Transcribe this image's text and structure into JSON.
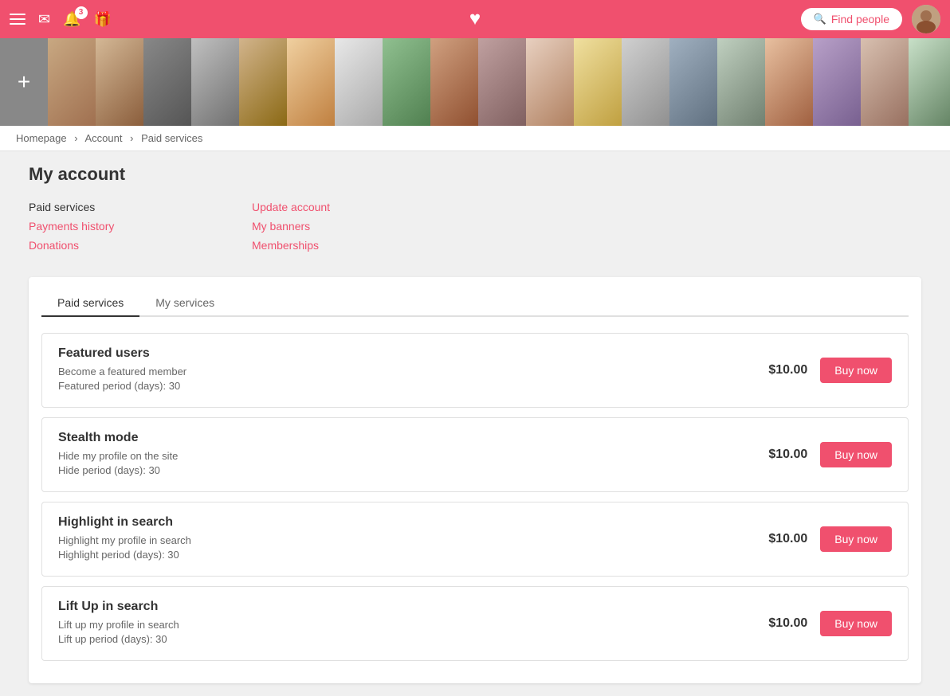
{
  "topnav": {
    "find_people_label": "Find people",
    "badge_count": "3"
  },
  "breadcrumb": {
    "home": "Homepage",
    "account": "Account",
    "current": "Paid services"
  },
  "page": {
    "title": "My account"
  },
  "account_menu": {
    "col1": [
      {
        "label": "Paid services",
        "active": false
      },
      {
        "label": "Payments history",
        "active": true
      },
      {
        "label": "Donations",
        "active": true
      }
    ],
    "col2": [
      {
        "label": "Update account",
        "active": true
      },
      {
        "label": "My banners",
        "active": true
      },
      {
        "label": "Memberships",
        "active": true
      }
    ]
  },
  "tabs": [
    {
      "label": "Paid services",
      "active": true
    },
    {
      "label": "My services",
      "active": false
    }
  ],
  "services": [
    {
      "title": "Featured users",
      "desc1": "Become a featured member",
      "desc2": "Featured period (days): 30",
      "price": "$10.00",
      "btn_label": "Buy now"
    },
    {
      "title": "Stealth mode",
      "desc1": "Hide my profile on the site",
      "desc2": "Hide period (days): 30",
      "price": "$10.00",
      "btn_label": "Buy now"
    },
    {
      "title": "Highlight in search",
      "desc1": "Highlight my profile in search",
      "desc2": "Highlight period (days): 30",
      "price": "$10.00",
      "btn_label": "Buy now"
    },
    {
      "title": "Lift Up in search",
      "desc1": "Lift up my profile in search",
      "desc2": "Lift up period (days): 30",
      "price": "$10.00",
      "btn_label": "Buy now"
    }
  ],
  "photos": [
    "face-1",
    "face-2",
    "face-3",
    "face-4",
    "face-5",
    "face-6",
    "face-7",
    "face-8",
    "face-9",
    "face-10",
    "face-11",
    "face-12",
    "face-13",
    "face-14",
    "face-15",
    "face-16",
    "face-17",
    "face-18",
    "face-19"
  ]
}
